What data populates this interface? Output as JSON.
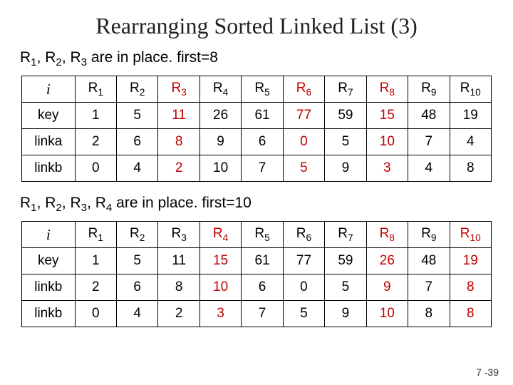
{
  "title": "Rearranging Sorted Linked List (3)",
  "caption1_prefix": "R",
  "caption1": "R1, R2, R3 are in place. first=8",
  "caption2": "R1, R2, R3, R4 are in place. first=10",
  "page_num": "7 -39",
  "table1": {
    "headers_i": "i",
    "cols": [
      "R1",
      "R2",
      "R3",
      "R4",
      "R5",
      "R6",
      "R7",
      "R8",
      "R9",
      "R10"
    ],
    "red_cols": [
      2,
      5,
      7
    ],
    "rows": [
      {
        "label": "key",
        "vals": [
          "1",
          "5",
          "11",
          "26",
          "61",
          "77",
          "59",
          "15",
          "48",
          "19"
        ],
        "red": [
          2,
          5,
          7
        ]
      },
      {
        "label": "linka",
        "vals": [
          "2",
          "6",
          "8",
          "9",
          "6",
          "0",
          "5",
          "10",
          "7",
          "4"
        ],
        "red": [
          2,
          5,
          7
        ]
      },
      {
        "label": "linkb",
        "vals": [
          "0",
          "4",
          "2",
          "10",
          "7",
          "5",
          "9",
          "3",
          "4",
          "8"
        ],
        "red": [
          2,
          5,
          7
        ]
      }
    ]
  },
  "table2": {
    "headers_i": "i",
    "cols": [
      "R1",
      "R2",
      "R3",
      "R4",
      "R5",
      "R6",
      "R7",
      "R8",
      "R9",
      "R10"
    ],
    "red_cols": [
      3,
      7,
      9
    ],
    "rows": [
      {
        "label": "key",
        "vals": [
          "1",
          "5",
          "11",
          "15",
          "61",
          "77",
          "59",
          "26",
          "48",
          "19"
        ],
        "red": [
          3,
          7,
          9
        ]
      },
      {
        "label": "linkb",
        "vals": [
          "2",
          "6",
          "8",
          "10",
          "6",
          "0",
          "5",
          "9",
          "7",
          "8"
        ],
        "red": [
          3,
          7,
          9
        ]
      },
      {
        "label": "linkb",
        "vals": [
          "0",
          "4",
          "2",
          "3",
          "7",
          "5",
          "9",
          "10",
          "8",
          "8"
        ],
        "red": [
          3,
          7,
          9
        ]
      }
    ]
  }
}
